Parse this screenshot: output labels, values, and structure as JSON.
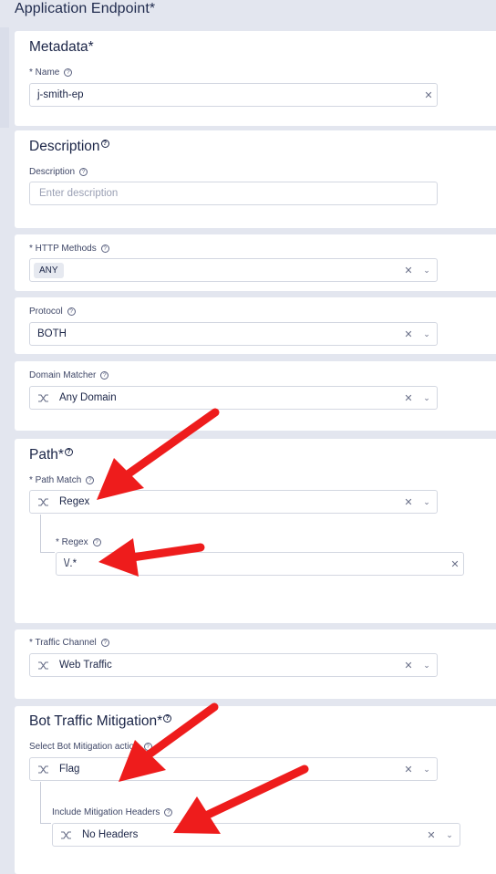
{
  "page": {
    "title": "Application Endpoint",
    "required_mark": "*"
  },
  "metadata": {
    "title": "Metadata",
    "required_mark": "*",
    "name_label": "* Name",
    "name_value": "j-smith-ep"
  },
  "description": {
    "title": "Description",
    "label": "Description",
    "placeholder": "Enter description"
  },
  "http_methods": {
    "label": "* HTTP Methods",
    "chip": "ANY"
  },
  "protocol": {
    "label": "Protocol",
    "value": "BOTH"
  },
  "domain_matcher": {
    "label": "Domain Matcher",
    "value": "Any Domain"
  },
  "path": {
    "title": "Path",
    "required_mark": "*",
    "match_label": "* Path Match",
    "match_value": "Regex",
    "regex_label": "* Regex",
    "regex_value": "\\/.*"
  },
  "traffic_channel": {
    "label": "* Traffic Channel",
    "value": "Web Traffic"
  },
  "bot_mitigation": {
    "title": "Bot Traffic Mitigation",
    "required_mark": "*",
    "action_label": "Select Bot Mitigation action",
    "action_value": "Flag",
    "headers_label": "Include Mitigation Headers",
    "headers_value": "No Headers"
  },
  "icons": {
    "help": "help-circle-icon",
    "clear": "clear-x-icon",
    "dropdown": "chevron-down-icon",
    "mode": "shuffle-mode-icon",
    "annotation": "red-arrow-icon"
  },
  "colors": {
    "annotation_red": "#ee1c1c",
    "text": "#1b2547",
    "background": "#e3e6ef"
  }
}
